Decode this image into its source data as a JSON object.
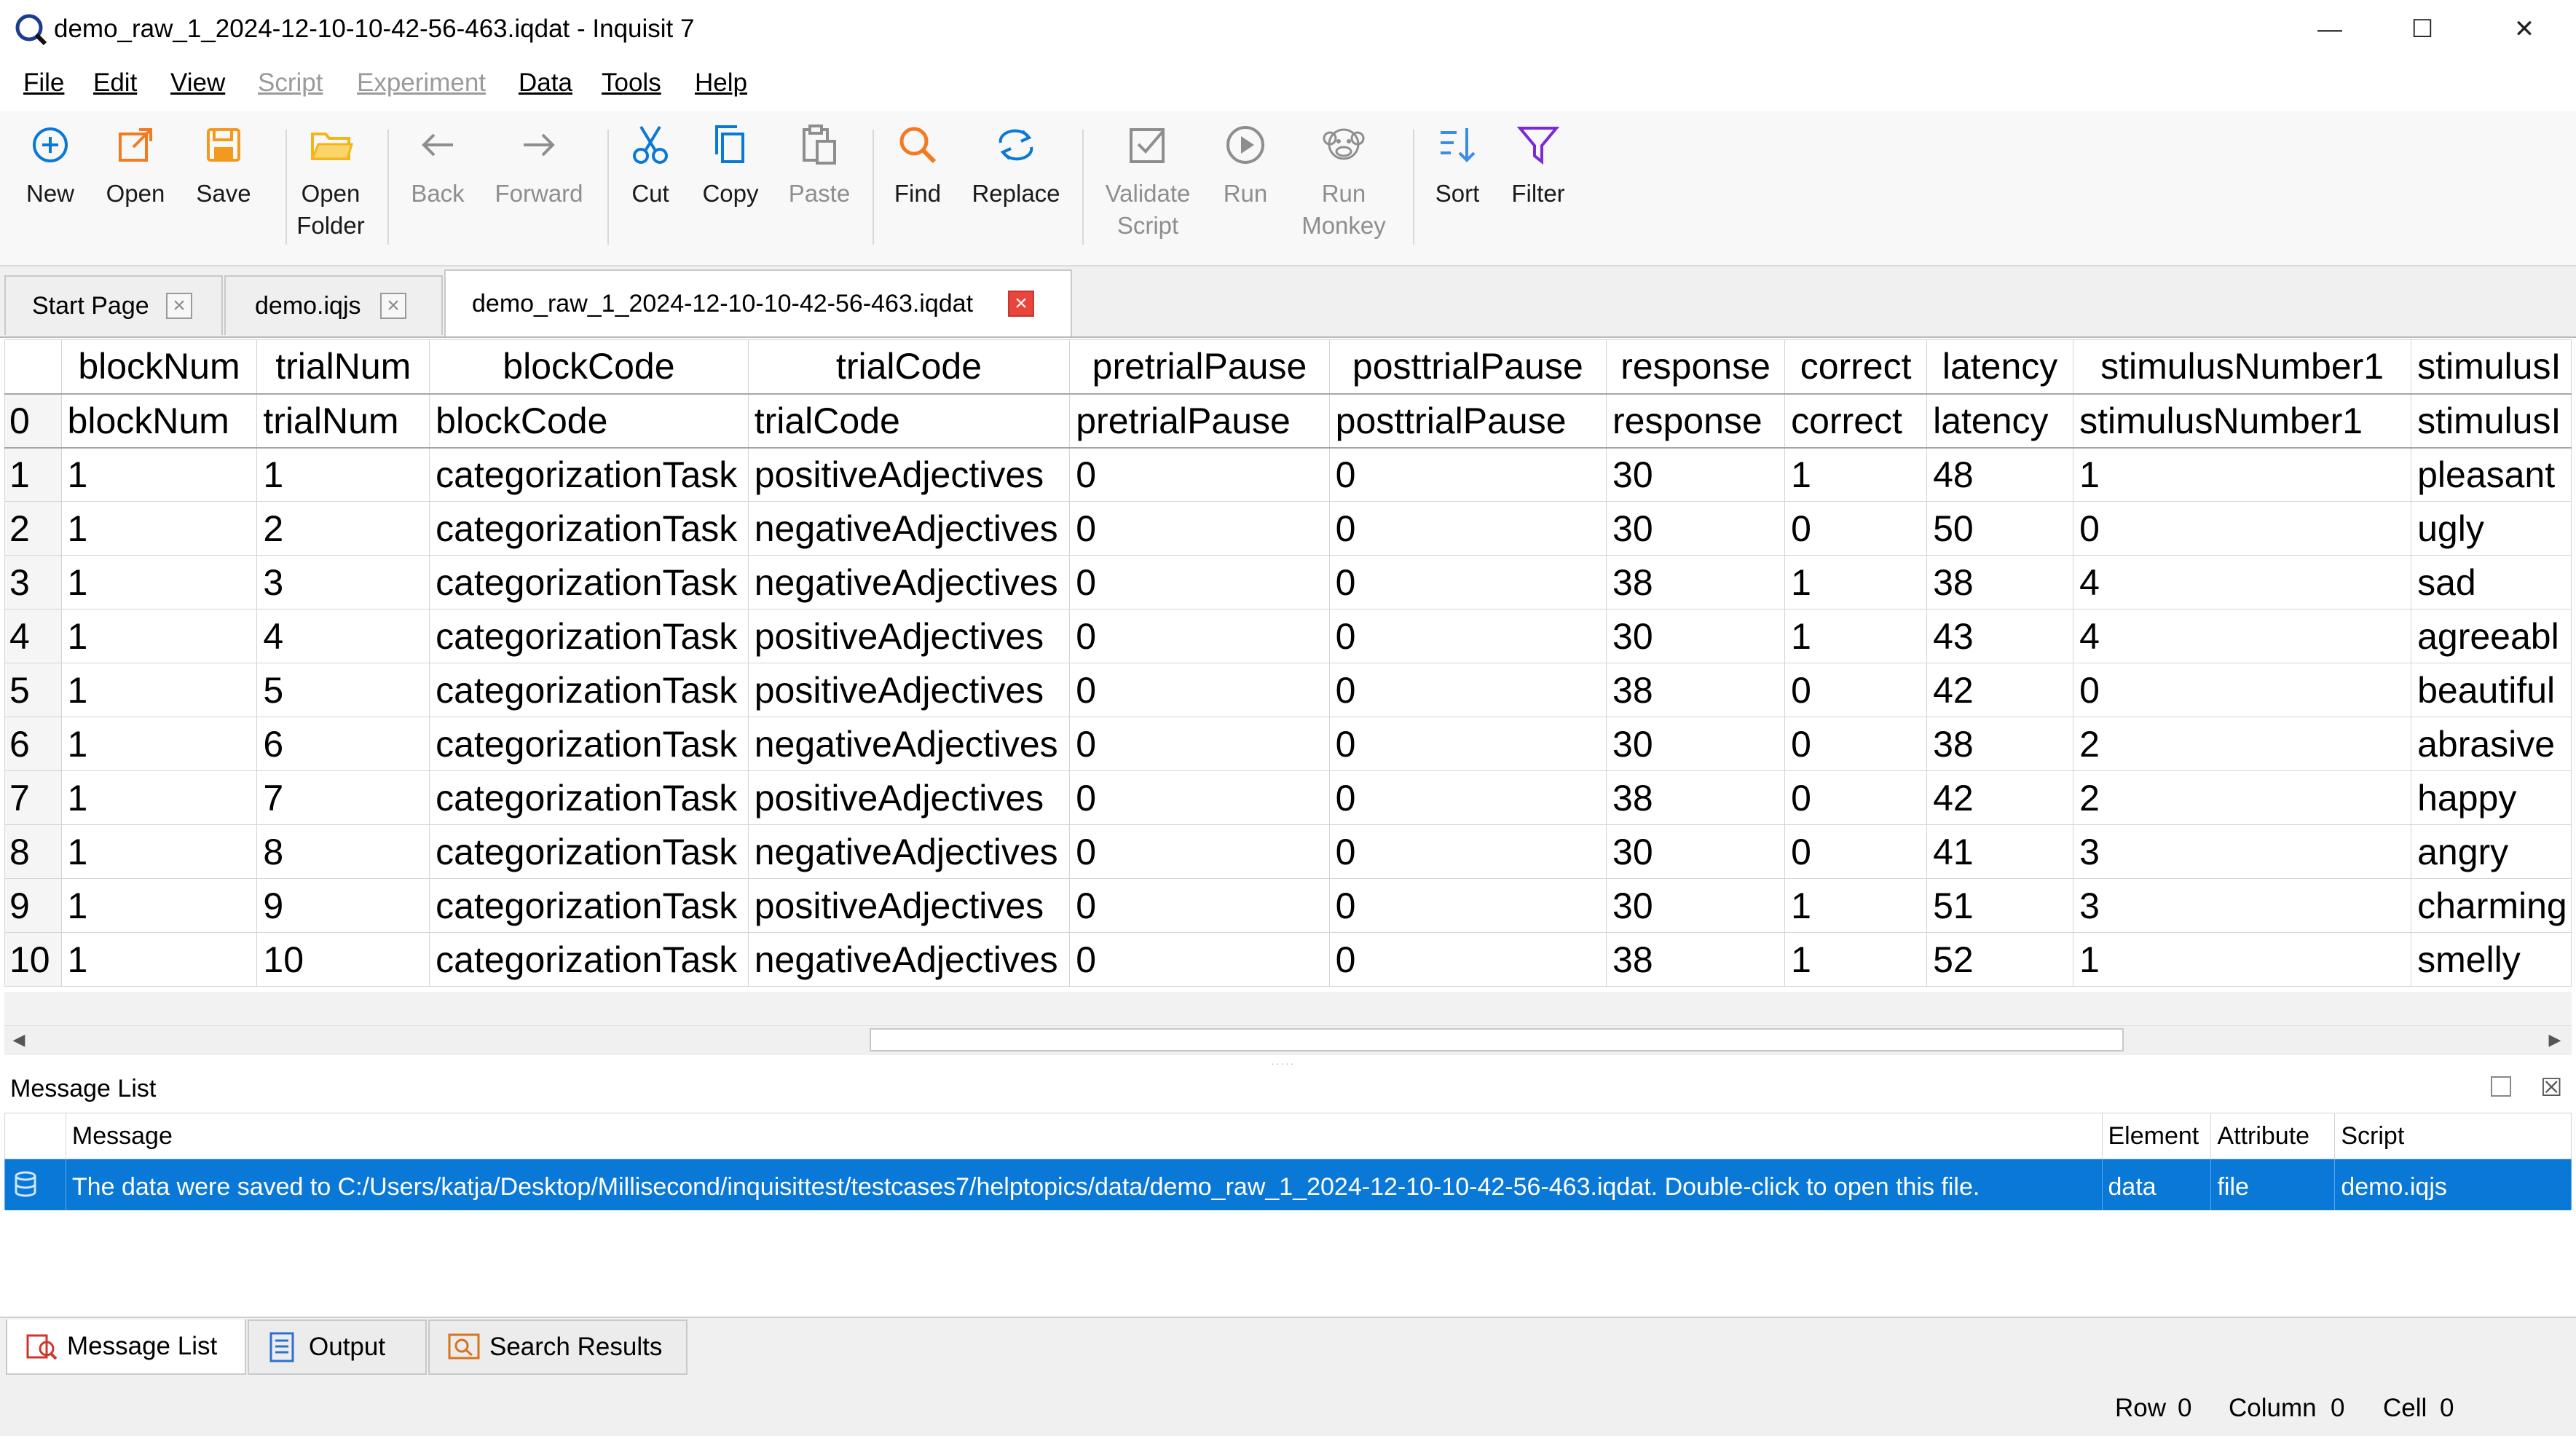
{
  "window": {
    "title": "demo_raw_1_2024-12-10-10-42-56-463.iqdat - Inquisit 7",
    "minimize": "—",
    "maximize": "☐",
    "close": "✕"
  },
  "menu": {
    "items": [
      {
        "label": "File",
        "enabled": true
      },
      {
        "label": "Edit",
        "enabled": true
      },
      {
        "label": "View",
        "enabled": true
      },
      {
        "label": "Script",
        "enabled": false
      },
      {
        "label": "Experiment",
        "enabled": false
      },
      {
        "label": "Data",
        "enabled": true
      },
      {
        "label": "Tools",
        "enabled": true
      },
      {
        "label": "Help",
        "enabled": true
      }
    ]
  },
  "toolbar": {
    "new": "New",
    "open": "Open",
    "save": "Save",
    "open_folder_1": "Open",
    "open_folder_2": "Folder",
    "back": "Back",
    "forward": "Forward",
    "cut": "Cut",
    "copy": "Copy",
    "paste": "Paste",
    "find": "Find",
    "replace": "Replace",
    "validate_1": "Validate",
    "validate_2": "Script",
    "run": "Run",
    "run_monkey_1": "Run",
    "run_monkey_2": "Monkey",
    "sort": "Sort",
    "filter": "Filter"
  },
  "tabs": [
    {
      "label": "Start Page",
      "active": false
    },
    {
      "label": "demo.iqjs",
      "active": false
    },
    {
      "label": "demo_raw_1_2024-12-10-10-42-56-463.iqdat",
      "active": true
    }
  ],
  "grid": {
    "columns": [
      "blockNum",
      "trialNum",
      "blockCode",
      "trialCode",
      "pretrialPause",
      "posttrialPause",
      "response",
      "correct",
      "latency",
      "stimulusNumber1",
      "stimulusI"
    ],
    "header_row": [
      "0",
      "blockNum",
      "trialNum",
      "blockCode",
      "trialCode",
      "pretrialPause",
      "posttrialPause",
      "response",
      "correct",
      "latency",
      "stimulusNumber1",
      "stimulusI"
    ],
    "rows": [
      [
        "1",
        "1",
        "1",
        "categorizationTask",
        "positiveAdjectives",
        "0",
        "0",
        "30",
        "1",
        "48",
        "1",
        "pleasant"
      ],
      [
        "2",
        "1",
        "2",
        "categorizationTask",
        "negativeAdjectives",
        "0",
        "0",
        "30",
        "0",
        "50",
        "0",
        "ugly"
      ],
      [
        "3",
        "1",
        "3",
        "categorizationTask",
        "negativeAdjectives",
        "0",
        "0",
        "38",
        "1",
        "38",
        "4",
        "sad"
      ],
      [
        "4",
        "1",
        "4",
        "categorizationTask",
        "positiveAdjectives",
        "0",
        "0",
        "30",
        "1",
        "43",
        "4",
        "agreeabl"
      ],
      [
        "5",
        "1",
        "5",
        "categorizationTask",
        "positiveAdjectives",
        "0",
        "0",
        "38",
        "0",
        "42",
        "0",
        "beautiful"
      ],
      [
        "6",
        "1",
        "6",
        "categorizationTask",
        "negativeAdjectives",
        "0",
        "0",
        "30",
        "0",
        "38",
        "2",
        "abrasive"
      ],
      [
        "7",
        "1",
        "7",
        "categorizationTask",
        "positiveAdjectives",
        "0",
        "0",
        "38",
        "0",
        "42",
        "2",
        "happy"
      ],
      [
        "8",
        "1",
        "8",
        "categorizationTask",
        "negativeAdjectives",
        "0",
        "0",
        "30",
        "0",
        "41",
        "3",
        "angry"
      ],
      [
        "9",
        "1",
        "9",
        "categorizationTask",
        "positiveAdjectives",
        "0",
        "0",
        "30",
        "1",
        "51",
        "3",
        "charming"
      ],
      [
        "10",
        "1",
        "10",
        "categorizationTask",
        "negativeAdjectives",
        "0",
        "0",
        "38",
        "1",
        "52",
        "1",
        "smelly"
      ]
    ]
  },
  "message_list": {
    "title": "Message List",
    "columns": [
      "Message",
      "Element",
      "Attribute",
      "Script"
    ],
    "rows": [
      {
        "message": "The data were saved to C:/Users/katja/Desktop/Millisecond/inquisittest/testcases7/helptopics/data/demo_raw_1_2024-12-10-10-42-56-463.iqdat. Double-click to open this file.",
        "element": "data",
        "attribute": "file",
        "script": "demo.iqjs"
      }
    ]
  },
  "bottom_tabs": [
    {
      "label": "Message List",
      "active": true
    },
    {
      "label": "Output",
      "active": false
    },
    {
      "label": "Search Results",
      "active": false
    }
  ],
  "status": {
    "row_label": "Row",
    "row_value": "0",
    "column_label": "Column",
    "column_value": "0",
    "cell_label": "Cell",
    "cell_value": "0"
  },
  "colors": {
    "accent_blue": "#0a78d7",
    "orange": "#f39a1e",
    "purple": "#7b2ad6",
    "close_red": "#e8453c"
  }
}
